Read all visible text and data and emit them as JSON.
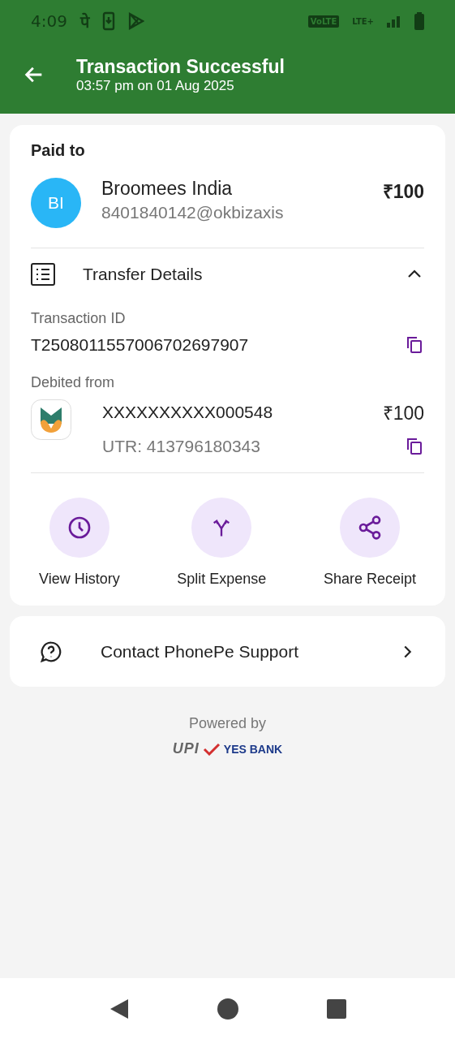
{
  "status_bar": {
    "time": "4:09",
    "notification_text": "पे",
    "volte": "VoLTE",
    "network": "LTE+"
  },
  "header": {
    "title": "Transaction Successful",
    "subtitle": "03:57 pm on 01 Aug 2025"
  },
  "payee": {
    "heading": "Paid to",
    "initials": "BI",
    "name": "Broomees India",
    "upi_id": "8401840142@okbizaxis",
    "amount": "₹100"
  },
  "transfer_details": {
    "title": "Transfer Details",
    "expanded": true,
    "transaction_id_label": "Transaction ID",
    "transaction_id": "T2508011557006702697907",
    "debited_label": "Debited from",
    "account": "XXXXXXXXXX000548",
    "account_amount": "₹100",
    "utr": "UTR: 413796180343"
  },
  "actions": [
    {
      "kind": "history",
      "label": "View History"
    },
    {
      "kind": "split",
      "label": "Split Expense"
    },
    {
      "kind": "share",
      "label": "Share Receipt"
    }
  ],
  "support": {
    "label": "Contact PhonePe Support"
  },
  "footer": {
    "powered_by": "Powered by",
    "upi": "UPI",
    "bank": "YES BANK"
  }
}
